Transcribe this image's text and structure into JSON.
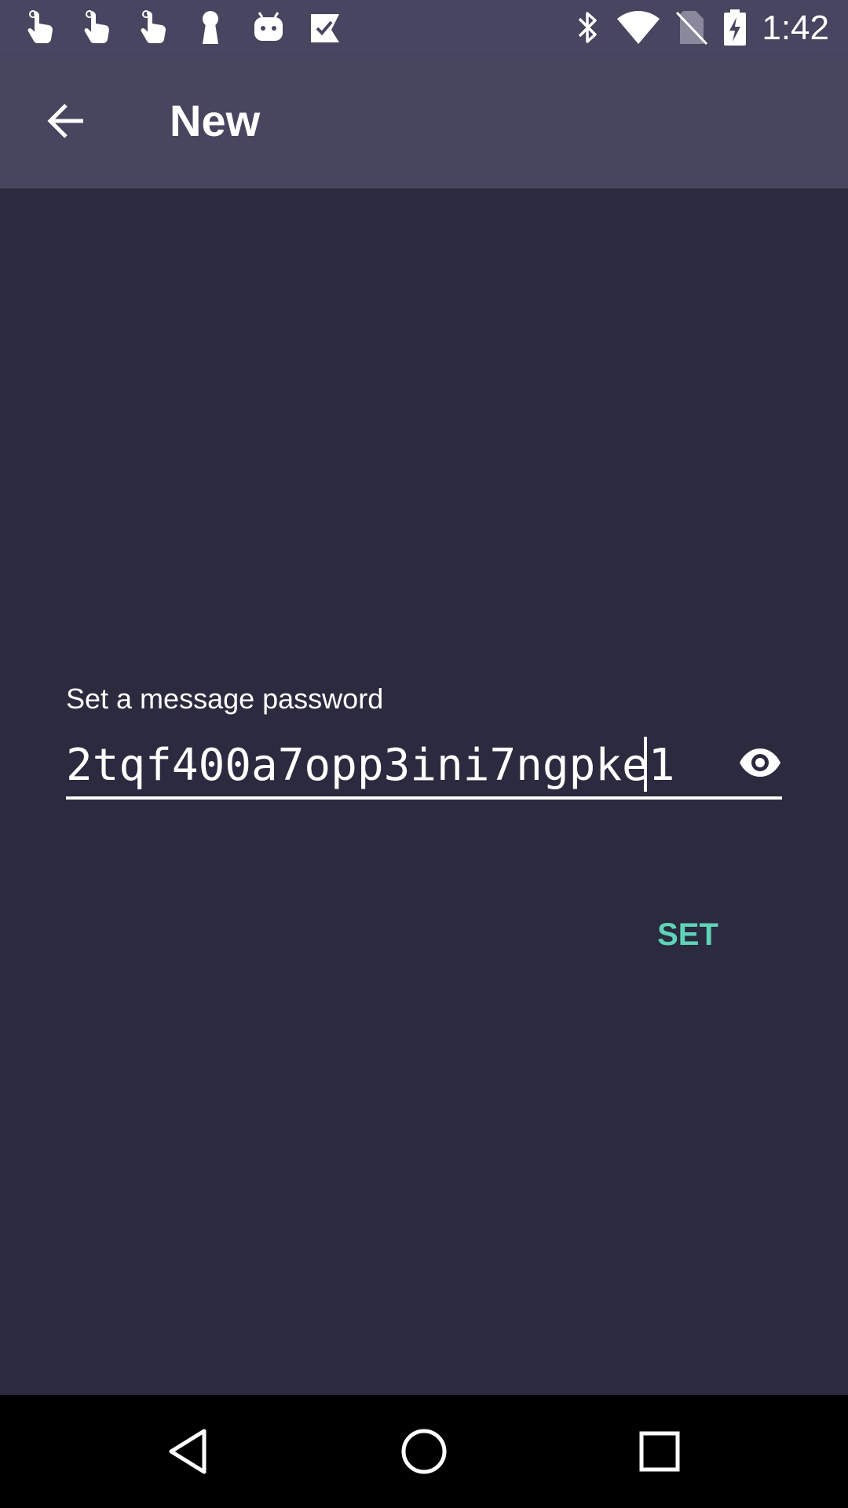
{
  "status_bar": {
    "time": "1:42",
    "left_icons": [
      "touch-icon",
      "touch-icon",
      "touch-icon",
      "keyhole-icon",
      "android-icon",
      "check-badge-icon"
    ],
    "right_icons": [
      "bluetooth-icon",
      "wifi-icon",
      "no-sim-icon",
      "battery-charging-icon"
    ]
  },
  "app_bar": {
    "title": "New",
    "back_icon": "arrow-left-icon"
  },
  "form": {
    "label": "Set a message password",
    "password_value": "2tqf400a7opp3ini7ngpke1",
    "visibility_icon": "eye-icon",
    "set_label": "SET"
  },
  "colors": {
    "status_bar": "#47455f",
    "app_bar": "#48465f",
    "background": "#2b2a3f",
    "accent": "#5fd4b8",
    "nav_bar": "#000000"
  },
  "nav_bar": {
    "buttons": [
      "back-triangle-icon",
      "home-circle-icon",
      "recents-square-icon"
    ]
  }
}
